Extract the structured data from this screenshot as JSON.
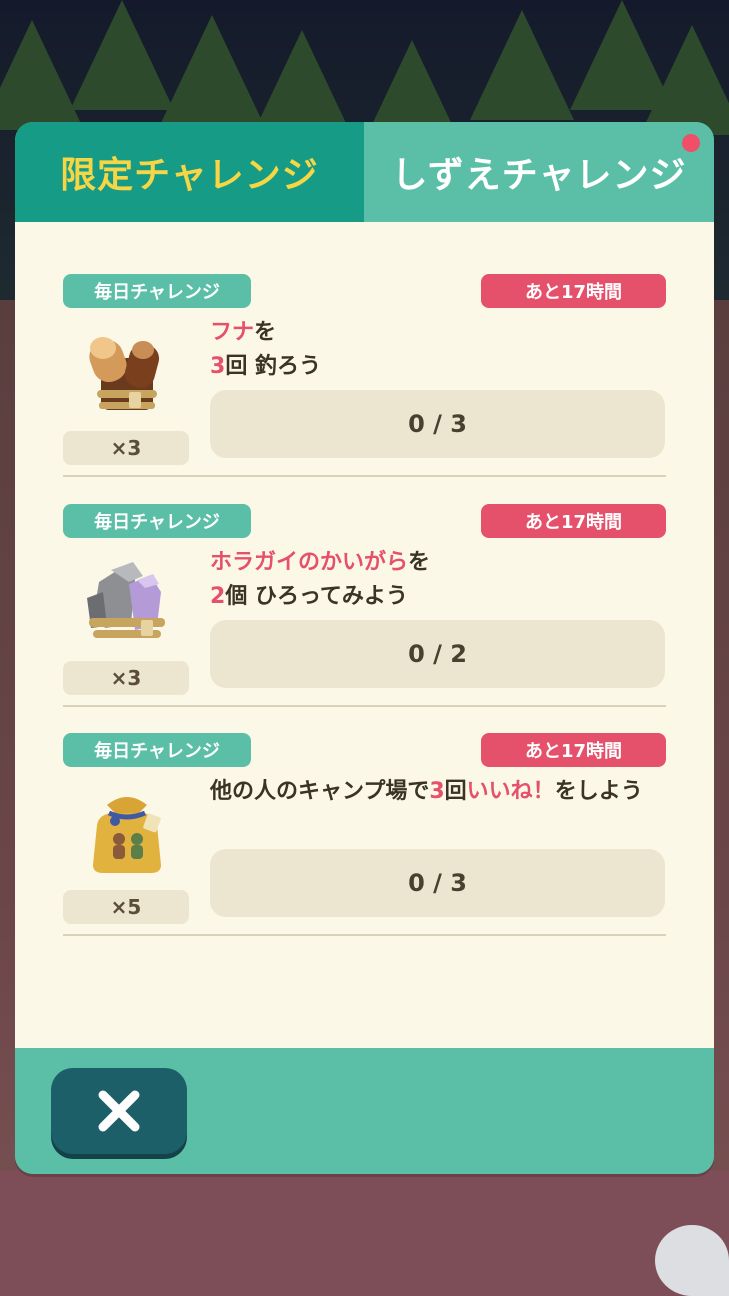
{
  "tabs": {
    "active_label": "限定チャレンジ",
    "inactive_label": "しずえチャレンジ"
  },
  "challenges": [
    {
      "category": "毎日チャレンジ",
      "time_left": "あと17時間",
      "reward_icon": "wood-bundle-icon",
      "reward_qty": "×3",
      "task": [
        {
          "text": "フナ",
          "highlight": true
        },
        {
          "text": "を",
          "highlight": false
        },
        {
          "text": "\n",
          "highlight": false
        },
        {
          "text": "3",
          "highlight": true
        },
        {
          "text": "回 釣ろう",
          "highlight": false
        }
      ],
      "progress": "0 / 3",
      "progress_value": 0,
      "progress_max": 3
    },
    {
      "category": "毎日チャレンジ",
      "time_left": "あと17時間",
      "reward_icon": "stone-bundle-icon",
      "reward_qty": "×3",
      "task": [
        {
          "text": "ホラガイのかいがら",
          "highlight": true
        },
        {
          "text": "を",
          "highlight": false
        },
        {
          "text": "\n",
          "highlight": false
        },
        {
          "text": "2",
          "highlight": true
        },
        {
          "text": "個 ひろってみよう",
          "highlight": false
        }
      ],
      "progress": "0 / 2",
      "progress_value": 0,
      "progress_max": 2
    },
    {
      "category": "毎日チャレンジ",
      "time_left": "あと17時間",
      "reward_icon": "gift-bag-icon",
      "reward_qty": "×5",
      "task": [
        {
          "text": "他の人のキャンプ場で",
          "highlight": false
        },
        {
          "text": "3",
          "highlight": true
        },
        {
          "text": "回",
          "highlight": false
        },
        {
          "text": "いいね！",
          "highlight": true
        },
        {
          "text": "をしよう",
          "highlight": false
        }
      ],
      "progress": "0 / 3",
      "progress_value": 0,
      "progress_max": 3
    }
  ],
  "footer": {
    "close_icon": "close-icon"
  },
  "colors": {
    "accent": "#5bbfa8",
    "active_tab": "#169c86",
    "active_tab_text": "#f6d645",
    "timer": "#e5506a",
    "highlight": "#e5506a"
  }
}
